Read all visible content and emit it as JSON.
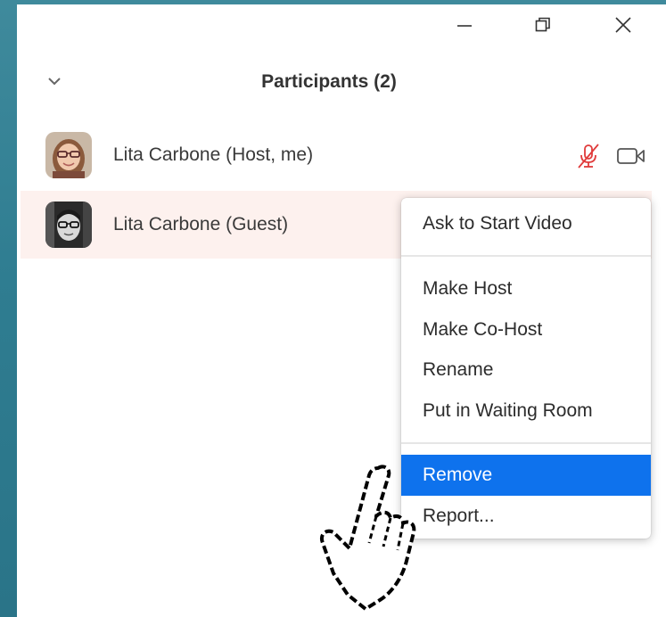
{
  "window": {
    "minimize_icon": "minimize-icon",
    "maximize_icon": "restore-icon",
    "close_icon": "close-icon"
  },
  "panel": {
    "collapse_icon": "chevron-down-icon",
    "title": "Participants (2)"
  },
  "participants": [
    {
      "name": "Lita Carbone (Host, me)",
      "mic_icon": "mic-muted-icon",
      "video_icon": "video-camera-icon"
    },
    {
      "name": "Lita Carbone (Guest)"
    }
  ],
  "context_menu": {
    "items": [
      {
        "label": "Ask to Start Video"
      },
      {
        "label": "Make Host"
      },
      {
        "label": "Make Co-Host"
      },
      {
        "label": "Rename"
      },
      {
        "label": "Put in Waiting Room"
      },
      {
        "label": "Remove",
        "selected": true
      },
      {
        "label": "Report..."
      }
    ]
  },
  "colors": {
    "selected": "#0e72ed",
    "muted": "#e03b3b",
    "guest_row_bg": "#fdf1ee",
    "backdrop": "#2f7d91"
  },
  "cursor_icon": "hand-pointer-icon"
}
